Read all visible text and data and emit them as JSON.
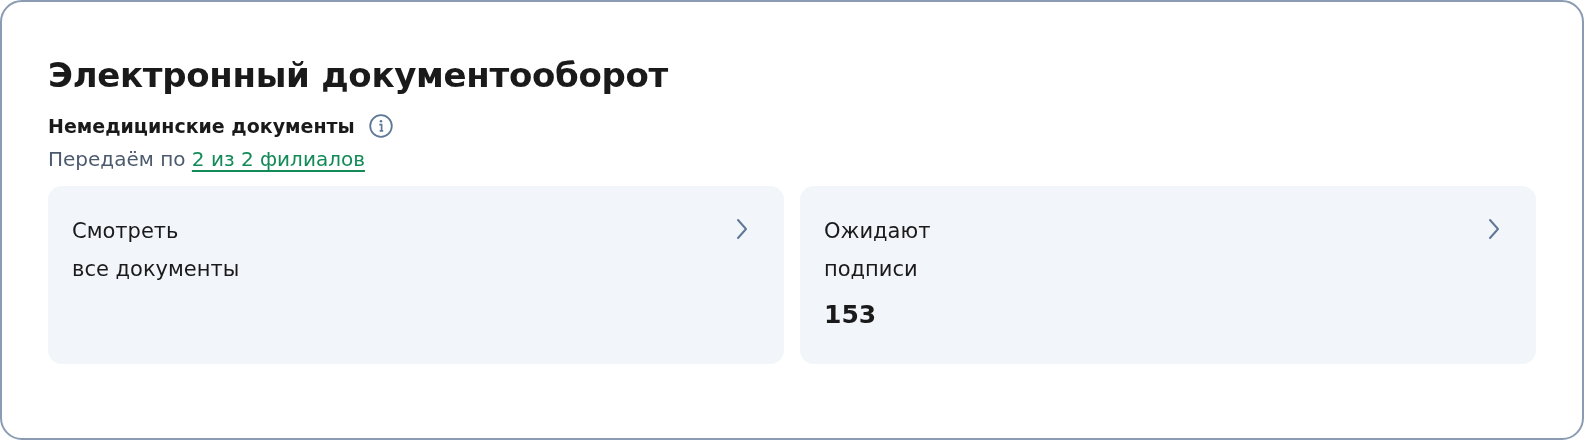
{
  "title": "Электронный документооборот",
  "section": {
    "heading": "Немедицинские документы",
    "status_text": "Передаём по",
    "status_link": "2 из 2 филиалов"
  },
  "tiles": [
    {
      "label": "Смотреть\nвсе документы"
    },
    {
      "label": "Ожидают\nподписи",
      "count": "153"
    }
  ]
}
